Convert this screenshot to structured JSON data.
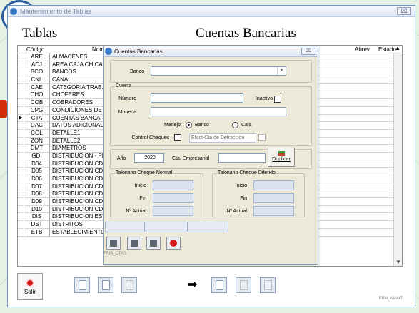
{
  "main_window": {
    "title": "Mantenimiento de Tablas",
    "left_heading": "Tablas",
    "right_heading": "Cuentas Bancarias",
    "form_code": "FRM_MANT",
    "exit_label": "Salir",
    "close_label": "⌧"
  },
  "grid": {
    "headers": {
      "code": "Código",
      "name": "Nombre",
      "abbrev": "Abrev.",
      "status": "Estado"
    },
    "current_row_marker": "▶",
    "rows": [
      {
        "code": "ARE",
        "name": "ALMACENES"
      },
      {
        "code": "ACJ",
        "name": "AREA CAJA CHICA"
      },
      {
        "code": "BCO",
        "name": "BANCOS"
      },
      {
        "code": "CNL",
        "name": "CANAL"
      },
      {
        "code": "CAE",
        "name": "CATEGORIA TRAB."
      },
      {
        "code": "CHO",
        "name": "CHOFERES"
      },
      {
        "code": "COB",
        "name": "COBRADORES"
      },
      {
        "code": "CPG",
        "name": "CONDICIONES DE PAGO"
      },
      {
        "code": "CTA",
        "name": "CUENTAS BANCARIAS"
      },
      {
        "code": "DAC",
        "name": "DATOS ADICIONALES"
      },
      {
        "code": "COL",
        "name": "DETALLE1"
      },
      {
        "code": "ZON",
        "name": "DETALLE2"
      },
      {
        "code": "DMT",
        "name": "DIAMETROS"
      },
      {
        "code": "GDI",
        "name": "DISTRIBUCION - PERSONAL"
      },
      {
        "code": "D04",
        "name": "DISTRIBUCION CDG"
      },
      {
        "code": "D05",
        "name": "DISTRIBUCION CDG"
      },
      {
        "code": "D06",
        "name": "DISTRIBUCION CDG"
      },
      {
        "code": "D07",
        "name": "DISTRIBUCION CDG"
      },
      {
        "code": "D08",
        "name": "DISTRIBUCION CDG"
      },
      {
        "code": "D09",
        "name": "DISTRIBUCION CDG"
      },
      {
        "code": "D10",
        "name": "DISTRIBUCION CDG"
      },
      {
        "code": "DIS",
        "name": "DISTRIBUCION ESTANDAR"
      },
      {
        "code": "DST",
        "name": "DISTRITOS"
      },
      {
        "code": "ETB",
        "name": "ESTABLECIMIENTOS"
      }
    ]
  },
  "dialog": {
    "title": "Cuentas Bancarias",
    "close_label": "⌧",
    "banco_label": "Banco",
    "banco_value": "",
    "cuenta_legend": "Cuenta",
    "numero_label": "Número",
    "numero_value": "",
    "inactivo_label": "Inactivo",
    "moneda_label": "Moneda",
    "moneda_value": "",
    "manejo_label": "Manejo",
    "manejo_banco": "Banco",
    "manejo_caja": "Caja",
    "control_cheques_label": "Control Cheques",
    "efact_label": "Efact-Cta de Detraccion",
    "anio_label": "Año",
    "anio_value": "2020",
    "cta_empresarial_label": "Cta. Empresarial",
    "cta_empresarial_value": "",
    "duplicar_label": "Duplicar",
    "normal_legend": "Talonario Cheque Normal",
    "diferido_legend": "Talonario Cheque Diferido",
    "inicio_label": "Inicio",
    "fin_label": "Fin",
    "nactual_label": "Nº Actual",
    "form_code": "FRM_CTAS"
  },
  "icons": {
    "dropdown": "chevron-down-icon",
    "scroll_up": "▲",
    "scroll_down": "▼",
    "arrow_right": "➡"
  }
}
